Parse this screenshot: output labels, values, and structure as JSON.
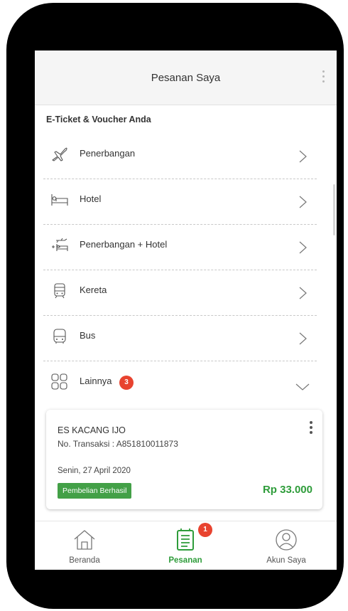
{
  "header": {
    "title": "Pesanan Saya"
  },
  "section_title": "E-Ticket & Voucher Anda",
  "categories": [
    {
      "label": "Penerbangan",
      "icon": "plane-icon"
    },
    {
      "label": "Hotel",
      "icon": "bed-icon"
    },
    {
      "label": "Penerbangan + Hotel",
      "icon": "plane-hotel-icon"
    },
    {
      "label": "Kereta",
      "icon": "train-icon"
    },
    {
      "label": "Bus",
      "icon": "bus-icon"
    },
    {
      "label": "Lainnya",
      "icon": "grid-icon",
      "badge": "3",
      "expanded": true
    }
  ],
  "order": {
    "name": "ES KACANG IJO",
    "transaction": "No. Transaksi : A851810011873",
    "date": "Senin, 27 April 2020",
    "status": "Pembelian Berhasil",
    "price": "Rp 33.000"
  },
  "nav": [
    {
      "label": "Beranda",
      "icon": "home-icon",
      "active": false
    },
    {
      "label": "Pesanan",
      "icon": "orders-icon",
      "active": true,
      "badge": "1"
    },
    {
      "label": "Akun Saya",
      "icon": "account-icon",
      "active": false
    }
  ],
  "colors": {
    "accent": "#2e9c3a",
    "badge": "#e8432f",
    "status_bg": "#43a047"
  }
}
